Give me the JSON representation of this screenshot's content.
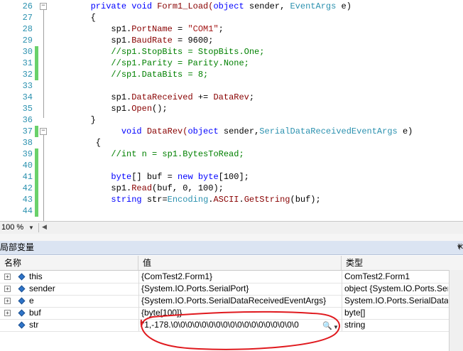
{
  "editor": {
    "lines": [
      {
        "num": "26",
        "fold": "minus",
        "green": false,
        "indent": "        ",
        "tokens": [
          {
            "t": "private void ",
            "c": "kw"
          },
          {
            "t": "Form1_Load(",
            "c": "fn"
          },
          {
            "t": "object ",
            "c": "kw"
          },
          {
            "t": "sender, ",
            "c": ""
          },
          {
            "t": "EventArgs ",
            "c": "ty"
          },
          {
            "t": "e)",
            "c": ""
          }
        ]
      },
      {
        "num": "27",
        "fold": "",
        "green": false,
        "indent": "        ",
        "tokens": [
          {
            "t": "{",
            "c": ""
          }
        ]
      },
      {
        "num": "28",
        "fold": "",
        "green": false,
        "indent": "            ",
        "tokens": [
          {
            "t": "sp1.",
            "c": ""
          },
          {
            "t": "PortName",
            "c": "fn"
          },
          {
            "t": " = ",
            "c": ""
          },
          {
            "t": "\"COM1\"",
            "c": "str"
          },
          {
            "t": ";",
            "c": ""
          }
        ]
      },
      {
        "num": "29",
        "fold": "",
        "green": false,
        "indent": "            ",
        "tokens": [
          {
            "t": "sp1.",
            "c": ""
          },
          {
            "t": "BaudRate",
            "c": "fn"
          },
          {
            "t": " = 9600;",
            "c": ""
          }
        ]
      },
      {
        "num": "30",
        "fold": "",
        "green": true,
        "indent": "            ",
        "tokens": [
          {
            "t": "//sp1.StopBits = StopBits.One;",
            "c": "cm"
          }
        ]
      },
      {
        "num": "31",
        "fold": "",
        "green": true,
        "indent": "            ",
        "tokens": [
          {
            "t": "//sp1.Parity = Parity.None;",
            "c": "cm"
          }
        ]
      },
      {
        "num": "32",
        "fold": "",
        "green": true,
        "indent": "            ",
        "tokens": [
          {
            "t": "//sp1.DataBits = 8;",
            "c": "cm"
          }
        ]
      },
      {
        "num": "33",
        "fold": "",
        "green": false,
        "indent": "",
        "tokens": []
      },
      {
        "num": "34",
        "fold": "",
        "green": false,
        "indent": "            ",
        "tokens": [
          {
            "t": "sp1.",
            "c": ""
          },
          {
            "t": "DataReceived",
            "c": "fn"
          },
          {
            "t": " += ",
            "c": ""
          },
          {
            "t": "DataRev",
            "c": "fn"
          },
          {
            "t": ";",
            "c": ""
          }
        ]
      },
      {
        "num": "35",
        "fold": "",
        "green": false,
        "indent": "            ",
        "tokens": [
          {
            "t": "sp1.",
            "c": ""
          },
          {
            "t": "Open",
            "c": "fn"
          },
          {
            "t": "();",
            "c": ""
          }
        ]
      },
      {
        "num": "36",
        "fold": "",
        "green": false,
        "indent": "        ",
        "tokens": [
          {
            "t": "}",
            "c": ""
          }
        ]
      },
      {
        "num": "37",
        "fold": "minus",
        "green": true,
        "indent": "              ",
        "tokens": [
          {
            "t": "void ",
            "c": "kw"
          },
          {
            "t": "DataRev(",
            "c": "fn"
          },
          {
            "t": "object ",
            "c": "kw"
          },
          {
            "t": "sender,",
            "c": ""
          },
          {
            "t": "SerialDataReceivedEventArgs ",
            "c": "ty"
          },
          {
            "t": "e)",
            "c": ""
          }
        ]
      },
      {
        "num": "38",
        "fold": "",
        "green": false,
        "indent": "        ",
        "tokens": [
          {
            "t": " {",
            "c": ""
          }
        ]
      },
      {
        "num": "39",
        "fold": "",
        "green": true,
        "indent": "            ",
        "tokens": [
          {
            "t": "//int n = sp1.BytesToRead;",
            "c": "cm"
          }
        ]
      },
      {
        "num": "40",
        "fold": "",
        "green": true,
        "indent": "",
        "tokens": []
      },
      {
        "num": "41",
        "fold": "",
        "green": true,
        "indent": "            ",
        "tokens": [
          {
            "t": "byte",
            "c": "kw"
          },
          {
            "t": "[] buf = ",
            "c": ""
          },
          {
            "t": "new byte",
            "c": "kw"
          },
          {
            "t": "[100];",
            "c": ""
          }
        ]
      },
      {
        "num": "42",
        "fold": "",
        "green": true,
        "indent": "            ",
        "tokens": [
          {
            "t": "sp1.",
            "c": ""
          },
          {
            "t": "Read",
            "c": "fn"
          },
          {
            "t": "(buf, 0, 100);",
            "c": ""
          }
        ]
      },
      {
        "num": "43",
        "fold": "",
        "green": true,
        "indent": "            ",
        "tokens": [
          {
            "t": "string ",
            "c": "kw"
          },
          {
            "t": "str=",
            "c": ""
          },
          {
            "t": "Encoding",
            "c": "ty"
          },
          {
            "t": ".",
            "c": ""
          },
          {
            "t": "ASCII",
            "c": "fn"
          },
          {
            "t": ".",
            "c": ""
          },
          {
            "t": "GetString",
            "c": "fn"
          },
          {
            "t": "(buf);",
            "c": ""
          }
        ]
      },
      {
        "num": "44",
        "fold": "",
        "green": true,
        "indent": "",
        "tokens": []
      }
    ],
    "zoom": "100 %"
  },
  "locals": {
    "title": "局部变量",
    "columns": {
      "name": "名称",
      "value": "值",
      "type": "类型"
    },
    "rows": [
      {
        "name": "this",
        "value": "{ComTest2.Form1}",
        "type": "ComTest2.Form1"
      },
      {
        "name": "sender",
        "value": "{System.IO.Ports.SerialPort}",
        "type": "object {System.IO.Ports.Seri"
      },
      {
        "name": "e",
        "value": "{System.IO.Ports.SerialDataReceivedEventArgs}",
        "type": "System.IO.Ports.SerialDataR"
      },
      {
        "name": "buf",
        "value": "{byte[100]}",
        "type": "byte[]"
      },
      {
        "name": "str",
        "value": "\"1,-178.\\0\\0\\0\\0\\0\\0\\0\\0\\0\\0\\0\\0\\0\\0\\0\\0\\0\\0",
        "type": "string"
      }
    ],
    "icons": {
      "expand": "expand-plus-icon",
      "variable": "field-diamond-icon",
      "inspect": "magnifier-icon"
    },
    "colors": {
      "annotation": "#e0191e",
      "diamond": "#2e74c9"
    }
  }
}
